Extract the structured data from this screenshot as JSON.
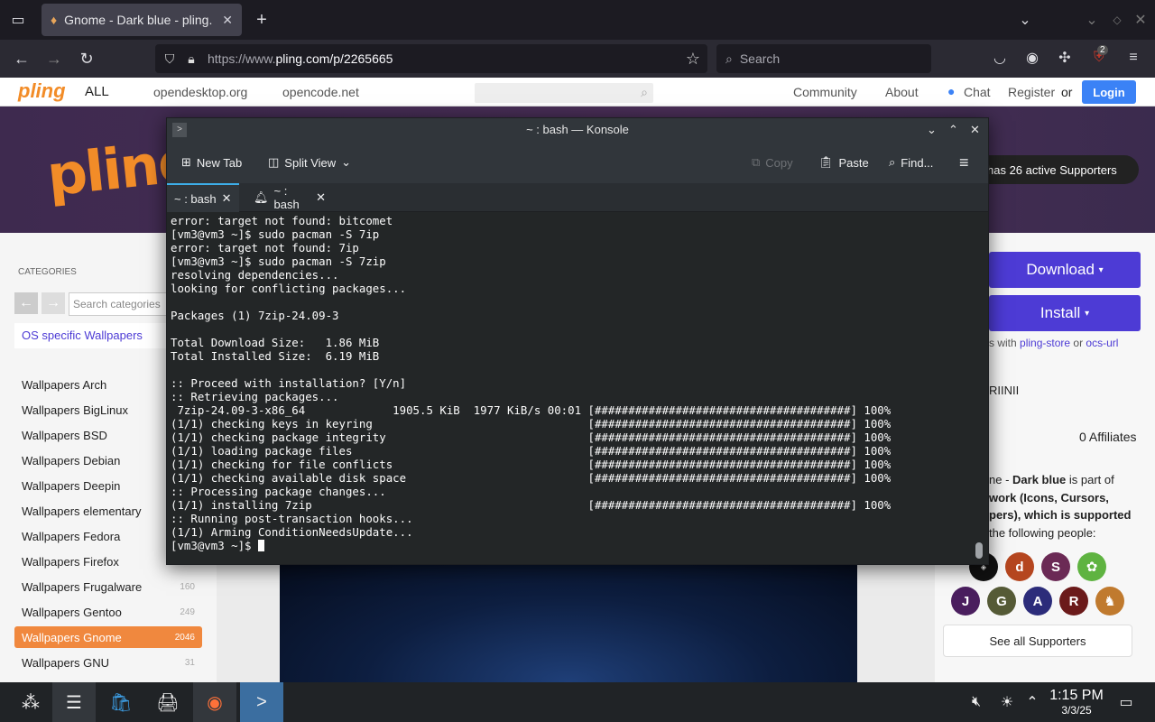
{
  "browser": {
    "tab_title": "Gnome - Dark blue - pling.",
    "url_proto": "https://www.",
    "url_host": "pling.com/p/2265665",
    "search_placeholder": "Search",
    "badge_count": "2"
  },
  "site": {
    "logo_small": "pling",
    "all_label": "ALL",
    "link1": "opendesktop.org",
    "link2": "opencode.net",
    "community": "Community",
    "about": "About",
    "chat": "Chat",
    "register": "Register",
    "or": "or",
    "login": "Login",
    "logo_big": "pling",
    "supporters_pill": "has 26 active Supporters"
  },
  "sidebar": {
    "categories_heading": "CATEGORIES",
    "search_placeholder": "Search categories",
    "os_specific": "OS specific Wallpapers",
    "items": [
      {
        "label": "Wallpapers Arch",
        "count": ""
      },
      {
        "label": "Wallpapers BigLinux",
        "count": ""
      },
      {
        "label": "Wallpapers BSD",
        "count": ""
      },
      {
        "label": "Wallpapers Debian",
        "count": ""
      },
      {
        "label": "Wallpapers Deepin",
        "count": ""
      },
      {
        "label": "Wallpapers elementary",
        "count": ""
      },
      {
        "label": "Wallpapers Fedora",
        "count": ""
      },
      {
        "label": "Wallpapers Firefox",
        "count": ""
      },
      {
        "label": "Wallpapers Frugalware",
        "count": "160"
      },
      {
        "label": "Wallpapers Gentoo",
        "count": "249"
      },
      {
        "label": "Wallpapers Gnome",
        "count": "2046"
      },
      {
        "label": "Wallpapers GNU",
        "count": "31"
      }
    ]
  },
  "right": {
    "download": "Download",
    "install": "Install",
    "with_text": "s with",
    "pling_store": "pling-store",
    "or": "or",
    "ocs_url": "ocs-url",
    "user": "RIINII",
    "affiliates": "0 Affiliates",
    "part_line1a": "ne - ",
    "part_line1b": "Dark blue",
    "part_line1c": " is part of",
    "part_line2": "work (Icons, Cursors,",
    "part_line3": "pers), which is supported",
    "part_line4": "the following people:",
    "avatars": [
      "d",
      "S",
      "J",
      "G",
      "A",
      "R"
    ],
    "see_all": "See all Supporters"
  },
  "konsole": {
    "title": "~ : bash — Konsole",
    "new_tab": "New Tab",
    "split_view": "Split View",
    "copy": "Copy",
    "paste": "Paste",
    "find": "Find...",
    "tab1": "~ : bash",
    "tab2": "~ : bash",
    "lines": [
      "error: target not found: bitcomet",
      "[vm3@vm3 ~]$ sudo pacman -S 7ip",
      "error: target not found: 7ip",
      "[vm3@vm3 ~]$ sudo pacman -S 7zip",
      "resolving dependencies...",
      "looking for conflicting packages...",
      "",
      "Packages (1) 7zip-24.09-3",
      "",
      "Total Download Size:   1.86 MiB",
      "Total Installed Size:  6.19 MiB",
      "",
      ":: Proceed with installation? [Y/n]",
      ":: Retrieving packages...",
      " 7zip-24.09-3-x86_64             1905.5 KiB  1977 KiB/s 00:01 [######################################] 100%",
      "(1/1) checking keys in keyring                                [######################################] 100%",
      "(1/1) checking package integrity                              [######################################] 100%",
      "(1/1) loading package files                                   [######################################] 100%",
      "(1/1) checking for file conflicts                             [######################################] 100%",
      "(1/1) checking available disk space                           [######################################] 100%",
      ":: Processing package changes...",
      "(1/1) installing 7zip                                         [######################################] 100%",
      ":: Running post-transaction hooks...",
      "(1/1) Arming ConditionNeedsUpdate...",
      "[vm3@vm3 ~]$ "
    ]
  },
  "taskbar": {
    "time": "1:15 PM",
    "date": "3/3/25"
  },
  "colors": {
    "accent_orange": "#f0883e",
    "purple_button": "#4d3bd5",
    "konsole_highlight": "#3daee9"
  }
}
